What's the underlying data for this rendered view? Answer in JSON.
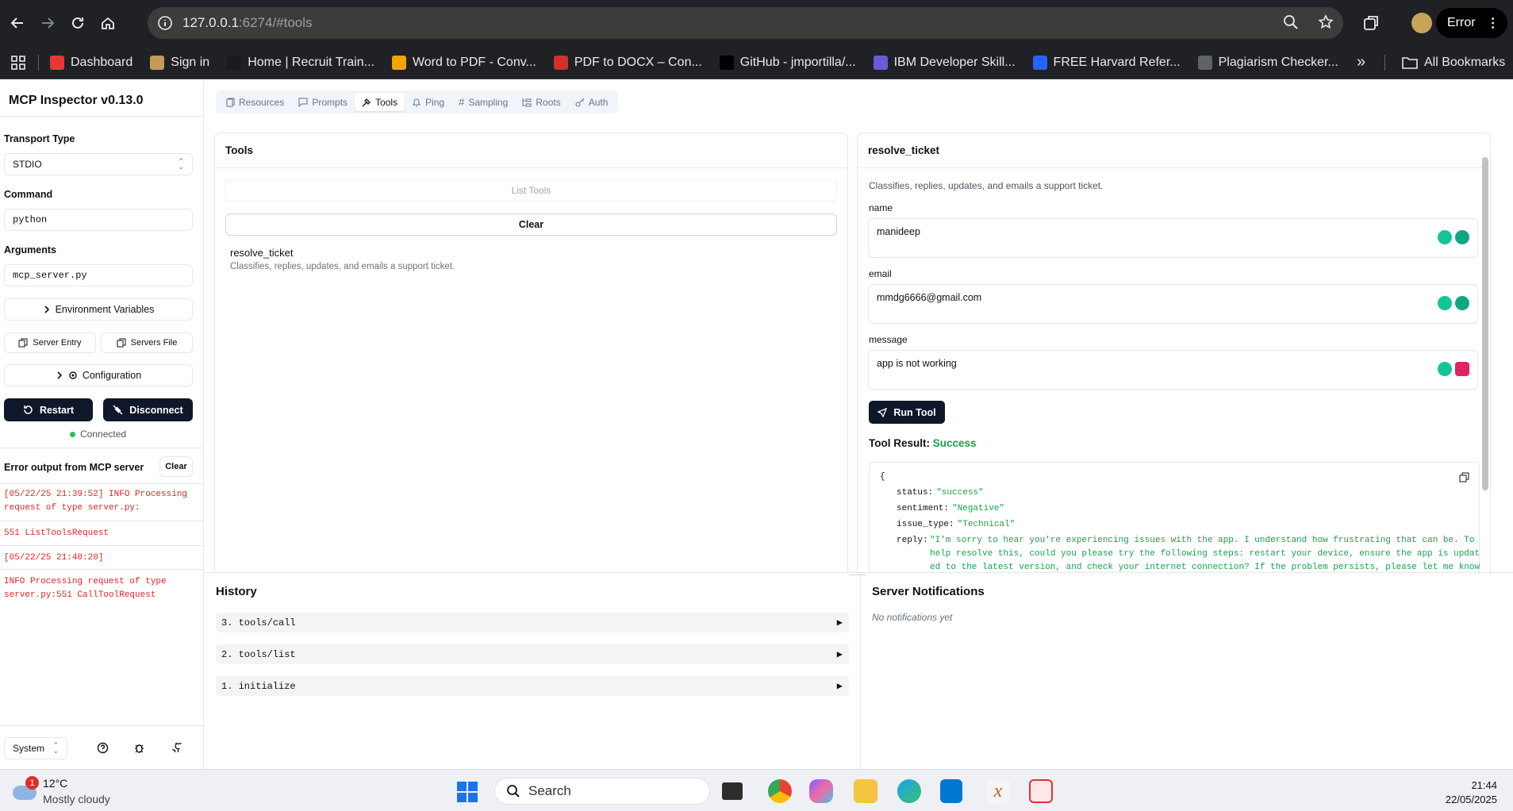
{
  "browser": {
    "url_host": "127.0.0.1",
    "url_rest": ":6274/#tools",
    "profile_status": "Error",
    "bookmarks": [
      {
        "label": "Dashboard",
        "color": "#e53935"
      },
      {
        "label": "Sign in",
        "color": "#c49b5b"
      },
      {
        "label": "Home | Recruit Train...",
        "color": "#1b1b1b"
      },
      {
        "label": "Word to PDF - Conv...",
        "color": "#f4a300"
      },
      {
        "label": "PDF to DOCX – Con...",
        "color": "#d32f2f"
      },
      {
        "label": "GitHub - jmportilla/...",
        "color": "#000000"
      },
      {
        "label": "IBM Developer Skill...",
        "color": "#6b5bd6"
      },
      {
        "label": "FREE Harvard Refer...",
        "color": "#2962ff"
      },
      {
        "label": "Plagiarism Checker...",
        "color": "#5f6368"
      }
    ],
    "all_bookmarks": "All Bookmarks"
  },
  "sidebar": {
    "title": "MCP Inspector v0.13.0",
    "transport_label": "Transport Type",
    "transport_value": "STDIO",
    "command_label": "Command",
    "command_value": "python",
    "arguments_label": "Arguments",
    "arguments_value": "mcp_server.py",
    "env_vars": "Environment Variables",
    "server_entry": "Server Entry",
    "servers_file": "Servers File",
    "configuration": "Configuration",
    "restart": "Restart",
    "disconnect": "Disconnect",
    "status": "Connected",
    "error_title": "Error output from MCP server",
    "clear": "Clear",
    "errors": [
      "[05/22/25 21:39:52] INFO Processing request of type server.py:",
      "551 ListToolsRequest",
      "[05/22/25 21:40:20]",
      "INFO Processing request of type server.py:551 CallToolRequest"
    ],
    "theme": "System"
  },
  "tabs": [
    "Resources",
    "Prompts",
    "Tools",
    "Ping",
    "Sampling",
    "Roots",
    "Auth"
  ],
  "tools_panel": {
    "title": "Tools",
    "list_tools": "List Tools",
    "clear": "Clear",
    "tool_name": "resolve_ticket",
    "tool_desc": "Classifies, replies, updates, and emails a support ticket."
  },
  "tool_detail": {
    "title": "resolve_ticket",
    "desc": "Classifies, replies, updates, and emails a support ticket.",
    "name_label": "name",
    "name_value": "manideep",
    "email_label": "email",
    "email_value": "mmdg6666@gmail.com",
    "message_label": "message",
    "message_value": "app is not working",
    "run_tool": "Run Tool",
    "result_label": "Tool Result:",
    "result_status": "Success",
    "json_open": "{",
    "result": [
      {
        "key": "status:",
        "value": "\"success\""
      },
      {
        "key": "sentiment:",
        "value": "\"Negative\""
      },
      {
        "key": "issue_type:",
        "value": "\"Technical\""
      }
    ],
    "reply_key": "reply:",
    "reply_lines": [
      "\"I'm sorry to hear you're experiencing issues with the app. I understand how frustrating that can be. To",
      "help resolve this, could you please try the following steps: restart your device, ensure the app is updat",
      "ed to the latest version, and check your internet connection? If the problem persists, please let me know"
    ]
  },
  "history": {
    "title": "History",
    "items": [
      "3. tools/call",
      "2. tools/list",
      "1. initialize"
    ]
  },
  "notifications": {
    "title": "Server Notifications",
    "empty": "No notifications yet"
  },
  "taskbar": {
    "weather_temp": "12°C",
    "weather_desc": "Mostly cloudy",
    "weather_badge": "1",
    "search": "Search",
    "time": "21:44",
    "date": "22/05/2025"
  }
}
